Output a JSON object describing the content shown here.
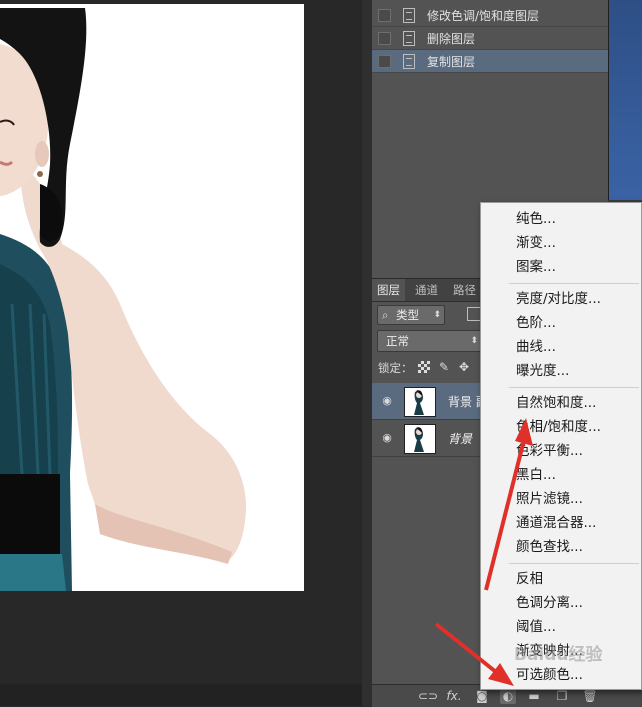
{
  "history": {
    "items": [
      {
        "label": "修改色调/饱和度图层",
        "selected": false
      },
      {
        "label": "删除图层",
        "selected": false
      },
      {
        "label": "复制图层",
        "selected": true
      }
    ]
  },
  "layers_panel": {
    "tabs": [
      "图层",
      "通道",
      "路径"
    ],
    "kind_filter": "类型",
    "blend_mode": "正常",
    "lock_label": "锁定：",
    "layers": [
      {
        "name": "背景 副",
        "selected": true,
        "italic": false
      },
      {
        "name": "背景",
        "selected": false,
        "italic": true
      }
    ],
    "footer_icons": [
      "link-icon",
      "fx-icon",
      "mask-icon",
      "adjustment-icon",
      "group-icon",
      "new-layer-icon",
      "trash-icon"
    ],
    "footer_fx": "fx."
  },
  "adjustment_menu": {
    "groups": [
      [
        "纯色...",
        "渐变...",
        "图案..."
      ],
      [
        "亮度/对比度...",
        "色阶...",
        "曲线...",
        "曝光度..."
      ],
      [
        "自然饱和度...",
        "色相/饱和度...",
        "色彩平衡...",
        "黑白...",
        "照片滤镜...",
        "通道混合器...",
        "颜色查找..."
      ],
      [
        "反相",
        "色调分离...",
        "阈值...",
        "渐变映射...",
        "可选颜色..."
      ]
    ]
  },
  "watermark": "Baidu经验",
  "colors": {
    "selection": "#5a6b80",
    "annotation_arrow": "#e0302a",
    "menu_bg": "#f2f2f2"
  }
}
